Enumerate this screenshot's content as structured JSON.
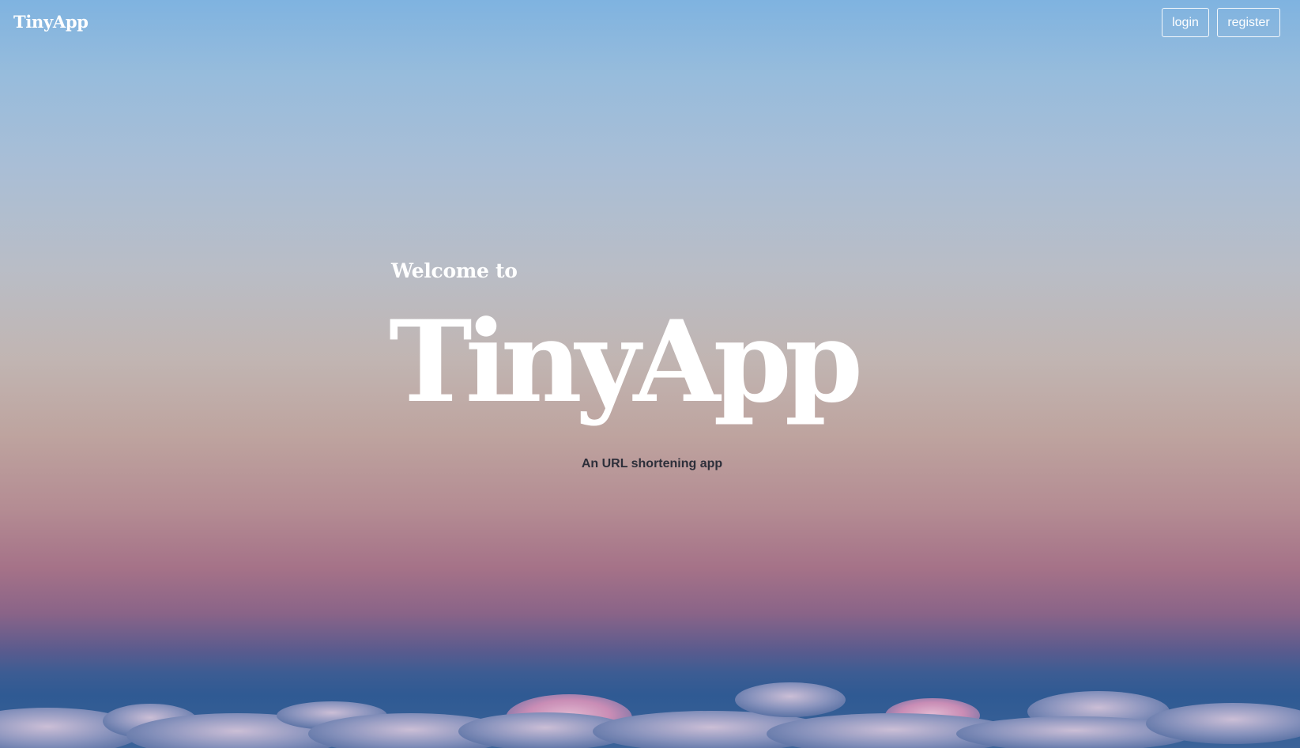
{
  "header": {
    "brand": "TinyApp",
    "login_label": "login",
    "register_label": "register"
  },
  "hero": {
    "welcome": "Welcome to",
    "title": "TinyApp",
    "subtitle": "An URL shortening app"
  },
  "colors": {
    "sky_top": "#7fb3e0",
    "sky_mid": "#c1b5b2",
    "sky_low": "#a57288",
    "horizon": "#2f5a93",
    "text_light": "#ffffff",
    "text_dark": "#2d2f3a"
  }
}
